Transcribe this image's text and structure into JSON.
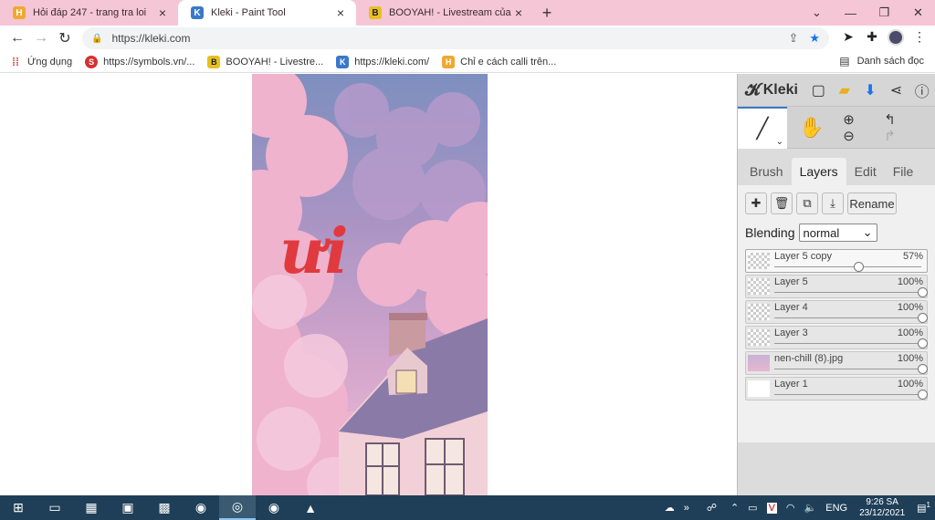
{
  "browser": {
    "tabs": [
      {
        "title": "Hỏi đáp 247 - trang tra loi",
        "favicon": "H",
        "color": "#f0a830",
        "active": false
      },
      {
        "title": "Kleki - Paint Tool",
        "favicon": "K",
        "color": "#3a78c9",
        "active": true
      },
      {
        "title": "BOOYAH! - Livestream của các g",
        "favicon": "B",
        "color": "#e8c020",
        "active": false
      }
    ],
    "url": "https://kleki.com",
    "bookmarks": [
      {
        "label": "Ứng dụng",
        "icon": "apps-grid-icon",
        "color": "#e04040"
      },
      {
        "label": "https://symbols.vn/...",
        "icon": "S",
        "color": "#d83030"
      },
      {
        "label": "BOOYAH! - Livestre...",
        "icon": "B",
        "color": "#e8c020"
      },
      {
        "label": "https://kleki.com/",
        "icon": "K",
        "color": "#3a78c9"
      },
      {
        "label": "Chỉ e cách calli trên...",
        "icon": "H",
        "color": "#f0a830"
      }
    ],
    "reading_list": "Danh sách đọc"
  },
  "canvas": {
    "text_art": "ưi"
  },
  "kleki": {
    "logo": "Kleki",
    "panel_tabs": [
      {
        "label": "Brush",
        "active": false
      },
      {
        "label": "Layers",
        "active": true
      },
      {
        "label": "Edit",
        "active": false
      },
      {
        "label": "File",
        "active": false
      }
    ],
    "rename_label": "Rename",
    "blending_label": "Blending",
    "blending_value": "normal",
    "layers": [
      {
        "name": "Layer 5 copy",
        "opacity": "57%",
        "value": 0.57,
        "thumb": "checker",
        "active": true
      },
      {
        "name": "Layer 5",
        "opacity": "100%",
        "value": 1.0,
        "thumb": "checker",
        "active": false
      },
      {
        "name": "Layer 4",
        "opacity": "100%",
        "value": 1.0,
        "thumb": "checker",
        "active": false
      },
      {
        "name": "Layer 3",
        "opacity": "100%",
        "value": 1.0,
        "thumb": "checker",
        "active": false
      },
      {
        "name": "nen-chill (8).jpg",
        "opacity": "100%",
        "value": 1.0,
        "thumb": "img",
        "active": false
      },
      {
        "name": "Layer 1",
        "opacity": "100%",
        "value": 1.0,
        "thumb": "white",
        "active": false
      }
    ]
  },
  "taskbar": {
    "language": "ENG",
    "time": "9:26 SA",
    "date": "23/12/2021",
    "notifications": "1"
  }
}
